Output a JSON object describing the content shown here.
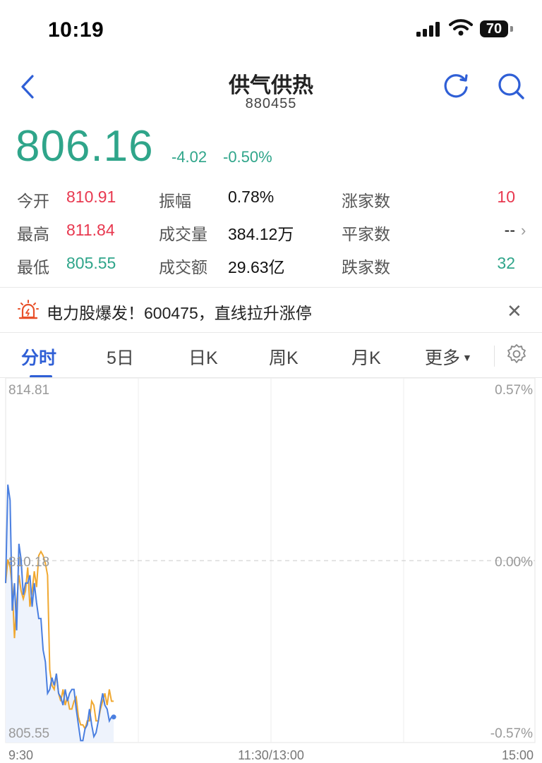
{
  "status_bar": {
    "time": "10:19",
    "battery": "70"
  },
  "header": {
    "title": "供气供热",
    "code": "880455"
  },
  "quote": {
    "price": "806.16",
    "change": "-4.02",
    "change_pct": "-0.50%"
  },
  "stats": {
    "open_label": "今开",
    "open": "810.91",
    "high_label": "最高",
    "high": "811.84",
    "low_label": "最低",
    "low": "805.55",
    "amplitude_label": "振幅",
    "amplitude": "0.78%",
    "volume_label": "成交量",
    "volume": "384.12万",
    "turnover_label": "成交额",
    "turnover": "29.63亿",
    "up_label": "涨家数",
    "up": "10",
    "flat_label": "平家数",
    "flat": "--",
    "down_label": "跌家数",
    "down": "32"
  },
  "banner": {
    "text": "电力股爆发！600475，直线拉升涨停"
  },
  "tabs": [
    {
      "label": "分时"
    },
    {
      "label": "5日"
    },
    {
      "label": "日K"
    },
    {
      "label": "周K"
    },
    {
      "label": "月K"
    },
    {
      "label": "更多"
    }
  ],
  "colors": {
    "up": "#e8384f",
    "down": "#2fa58a",
    "accent": "#2f5fd6",
    "price_line": "#4a7fe0",
    "avg_line": "#f0a830"
  },
  "chart_data": {
    "type": "line",
    "y_left_ticks": [
      "814.81",
      "810.18",
      "805.55"
    ],
    "y_right_ticks": [
      "0.57%",
      "0.00%",
      "-0.57%"
    ],
    "x_ticks": [
      "9:30",
      "11:30/13:00",
      "15:00"
    ],
    "ylim": [
      805.55,
      814.81
    ],
    "reference_price": 810.18,
    "total_minutes": 240,
    "series": [
      {
        "minute": [
          0,
          1,
          2,
          3,
          4,
          5,
          6,
          7,
          8,
          9,
          10,
          11,
          12,
          13,
          14,
          15,
          16,
          17,
          18,
          19,
          20,
          21,
          22,
          23,
          24,
          25,
          26,
          27,
          28,
          29,
          30,
          31,
          32,
          33,
          34,
          35,
          36,
          37,
          38,
          39,
          40,
          41,
          42,
          43,
          44,
          45,
          46,
          47,
          48,
          49
        ],
        "values": [
          809.6,
          812.1,
          811.7,
          808.9,
          809.6,
          808.4,
          810.6,
          810.2,
          809.3,
          809.6,
          809.6,
          809.8,
          809.0,
          809.6,
          809.1,
          808.7,
          808.7,
          807.9,
          807.6,
          806.8,
          806.9,
          807.2,
          807.0,
          807.3,
          806.8,
          806.7,
          806.5,
          806.9,
          806.6,
          806.8,
          806.9,
          806.9,
          806.4,
          806.0,
          805.6,
          805.6,
          805.9,
          806.0,
          806.4,
          806.0,
          805.7,
          805.8,
          806.1,
          806.5,
          806.8,
          806.5,
          806.4,
          806.1,
          806.2,
          806.2
        ]
      },
      {
        "minute": [
          0,
          1,
          2,
          3,
          4,
          5,
          6,
          7,
          8,
          9,
          10,
          11,
          12,
          13,
          14,
          15,
          16,
          17,
          18,
          19,
          20,
          21,
          22,
          23,
          24,
          25,
          26,
          27,
          28,
          29,
          30,
          31,
          32,
          33,
          34,
          35,
          36,
          37,
          38,
          39,
          40,
          41,
          42,
          43,
          44,
          45,
          46,
          47,
          48,
          49
        ],
        "values": [
          809.6,
          810.2,
          810.0,
          809.5,
          808.2,
          809.1,
          809.8,
          809.4,
          809.2,
          809.4,
          810.0,
          809.0,
          809.4,
          809.9,
          809.5,
          810.3,
          810.4,
          810.3,
          810.1,
          809.8,
          807.4,
          807.0,
          806.9,
          807.3,
          806.8,
          806.6,
          806.9,
          806.5,
          806.7,
          806.4,
          806.4,
          806.6,
          806.7,
          806.2,
          806.0,
          806.0,
          805.9,
          806.1,
          806.1,
          806.6,
          806.5,
          806.1,
          806.1,
          806.4,
          806.6,
          806.8,
          806.5,
          806.9,
          806.6,
          806.6
        ]
      }
    ]
  }
}
